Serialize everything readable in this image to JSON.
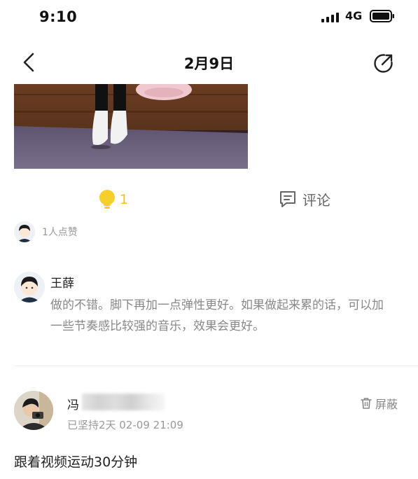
{
  "status_bar": {
    "time": "9:10",
    "network": "4G"
  },
  "nav": {
    "title": "2月9日"
  },
  "actions": {
    "like_count": "1",
    "comment_label": "评论"
  },
  "likes": {
    "summary": "1人点赞"
  },
  "comment": {
    "author": "王薛",
    "text": "做的不错。脚下再加一点弹性更好。如果做起来累的话，可以加一些节奏感比较强的音乐，效果会更好。"
  },
  "post": {
    "author_visible": "冯",
    "meta": "已坚持2天 02-09 21:09",
    "block_label": "屏蔽",
    "text": "跟着视频运动30分钟"
  },
  "colors": {
    "like_accent": "#f4c21a",
    "muted_text": "#999999",
    "divider": "#ededed"
  },
  "icons": [
    "back-arrow-icon",
    "share-icon",
    "lightbulb-icon",
    "comment-icon",
    "trash-icon",
    "signal-icon",
    "battery-icon"
  ]
}
